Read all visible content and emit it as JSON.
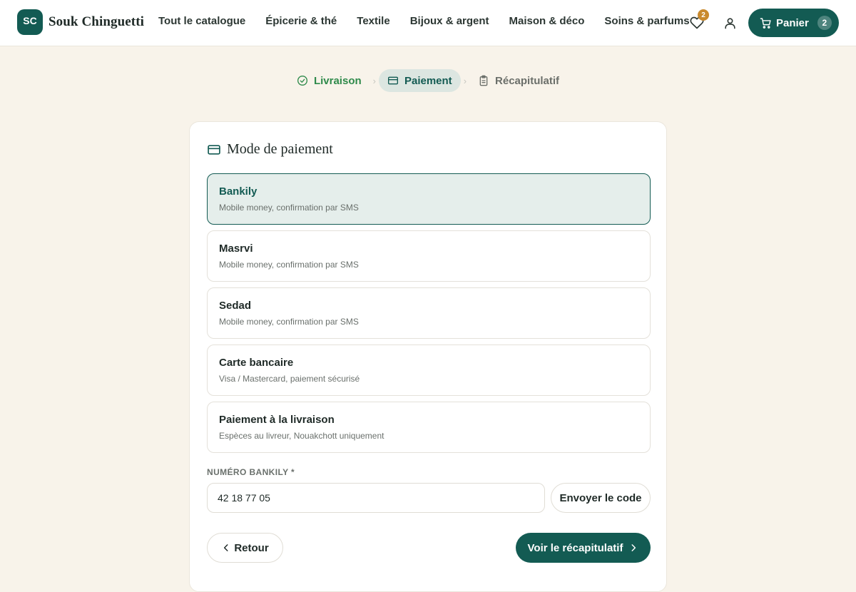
{
  "brand": {
    "initials": "SC",
    "name": "Souk Chinguetti"
  },
  "nav": {
    "items": [
      {
        "label": "Tout le catalogue"
      },
      {
        "label": "Épicerie & thé"
      },
      {
        "label": "Textile"
      },
      {
        "label": "Bijoux & argent"
      },
      {
        "label": "Maison & déco"
      },
      {
        "label": "Soins & parfums"
      }
    ]
  },
  "header": {
    "favorites_count": "2",
    "favorites_icon": "heart-icon",
    "account_icon": "user-icon",
    "cart_label": "Panier",
    "cart_count": "2",
    "cart_icon": "cart-icon"
  },
  "steps": [
    {
      "label": "Livraison",
      "state": "done",
      "icon": "check-circle-icon"
    },
    {
      "label": "Paiement",
      "state": "active",
      "icon": "credit-card-icon"
    },
    {
      "label": "Récapitulatif",
      "state": "todo",
      "icon": "clipboard-icon"
    }
  ],
  "payment": {
    "title": "Mode de paiement",
    "options": [
      {
        "name": "Bankily",
        "desc": "Mobile money, confirmation par SMS",
        "selected": true
      },
      {
        "name": "Masrvi",
        "desc": "Mobile money, confirmation par SMS",
        "selected": false
      },
      {
        "name": "Sedad",
        "desc": "Mobile money, confirmation par SMS",
        "selected": false
      },
      {
        "name": "Carte bancaire",
        "desc": "Visa / Mastercard, paiement sécurisé",
        "selected": false
      },
      {
        "name": "Paiement à la livraison",
        "desc": "Espèces au livreur, Nouakchott uniquement",
        "selected": false
      }
    ],
    "phone_label": "NUMÉRO BANKILY *",
    "phone_value": "42 18 77 05",
    "send_code_label": "Envoyer le code",
    "back_label": "Retour",
    "next_label": "Voir le récapitulatif"
  },
  "colors": {
    "accent": "#135b53",
    "background": "#f8f3ea",
    "done": "#2f8a4b",
    "badge": "#c98a2e"
  }
}
